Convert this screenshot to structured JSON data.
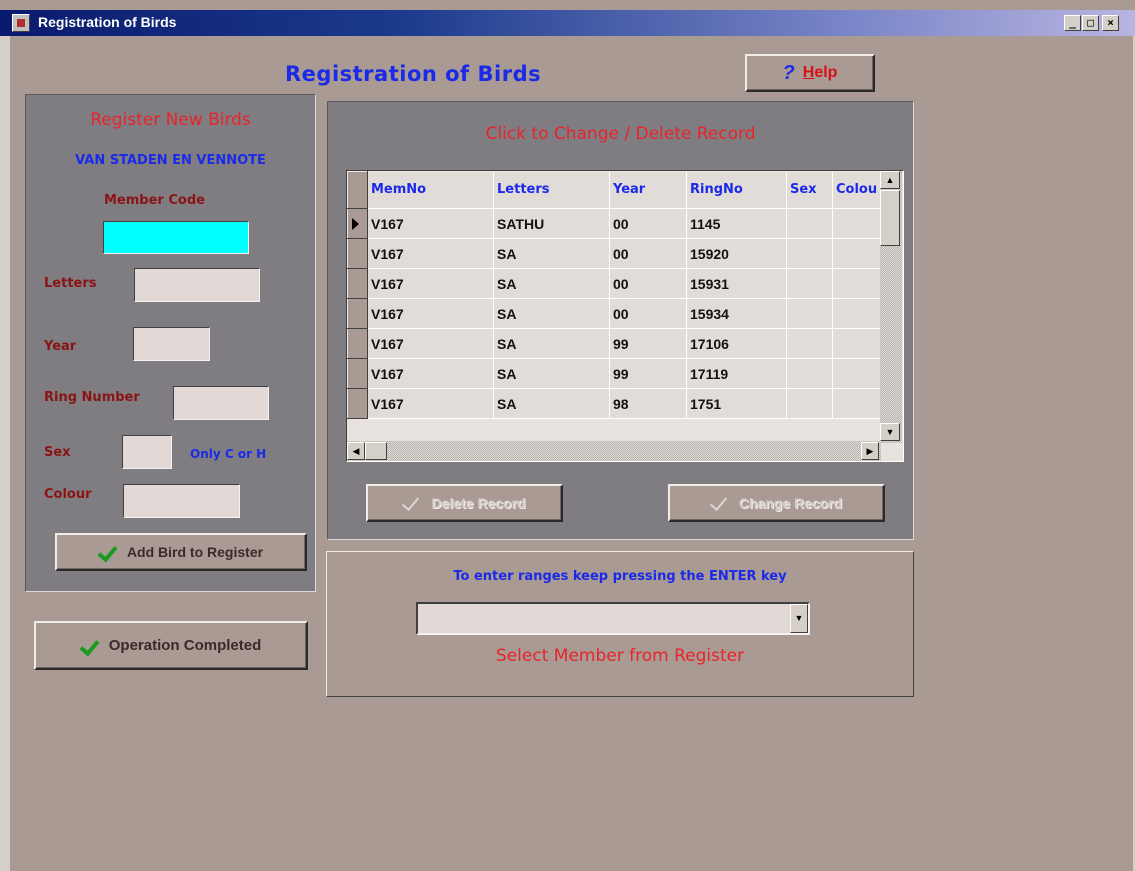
{
  "window": {
    "title": "Registration of Birds",
    "controls": [
      "_",
      "□",
      "×"
    ]
  },
  "header": {
    "title": "Registration of Birds"
  },
  "help": {
    "q": "?",
    "label": "Help"
  },
  "register_panel": {
    "heading": "Register New Birds",
    "member_name": "VAN STADEN EN VENNOTE",
    "member_code_label": "Member Code",
    "member_code_value": "",
    "letters_label": "Letters",
    "year_label": "Year",
    "ring_label": "Ring Number",
    "sex_label": "Sex",
    "sex_hint": "Only C or H",
    "colour_label": "Colour",
    "add_button": "Add Bird to Register"
  },
  "operation_button": "Operation Completed",
  "records_panel": {
    "heading": "Click to Change / Delete Record",
    "columns": [
      "MemNo",
      "Letters",
      "Year",
      "RingNo",
      "Sex",
      "Colou"
    ],
    "rows": [
      [
        "V167",
        "SATHU",
        "00",
        "1145",
        "",
        ""
      ],
      [
        "V167",
        "SA",
        "00",
        "15920",
        "",
        ""
      ],
      [
        "V167",
        "SA",
        "00",
        "15931",
        "",
        ""
      ],
      [
        "V167",
        "SA",
        "00",
        "15934",
        "",
        ""
      ],
      [
        "V167",
        "SA",
        "99",
        "17106",
        "",
        ""
      ],
      [
        "V167",
        "SA",
        "99",
        "17119",
        "",
        ""
      ],
      [
        "V167",
        "SA",
        "98",
        "1751",
        "",
        ""
      ]
    ],
    "delete_button": "Delete Record",
    "change_button": "Change Record"
  },
  "select_panel": {
    "hint": "To enter ranges keep pressing the ENTER key",
    "combo_value": "",
    "caption": "Select Member from Register"
  }
}
